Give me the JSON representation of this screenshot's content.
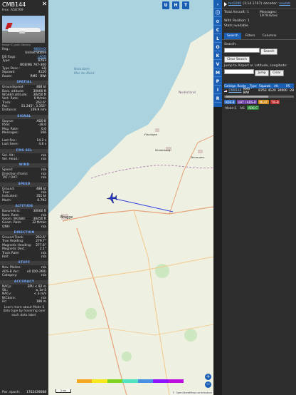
{
  "left": {
    "callsign": "CMB144",
    "hex_line": "Hex: A58769",
    "photo_credit": "Image © Justin Stevens",
    "basic": [
      {
        "k": "Reg.:",
        "v": "N669AX",
        "link": true
      },
      {
        "k": "",
        "v": "United States",
        "link": false
      },
      {
        "k": "DB flags:",
        "v": "LADD",
        "link": true
      },
      {
        "k": "Type:",
        "v": "B763",
        "link": false
      },
      {
        "k": "",
        "v": "BOEING 767-300",
        "link": false
      },
      {
        "k": "Type Desc.:",
        "v": "L2J",
        "link": false
      },
      {
        "k": "Squawk:",
        "v": "4120",
        "link": false
      },
      {
        "k": "Route:",
        "v": "RMS - BWI",
        "link": false
      }
    ],
    "sections": [
      {
        "title": "SPATIAL",
        "rows": [
          {
            "k": "Groundspeed:",
            "v": "488 kt"
          },
          {
            "k": "Baro. altitude:",
            "v": "30000 ft"
          },
          {
            "k": "WGS84 altitude:",
            "v": "30450 ft"
          },
          {
            "k": "Vert. Rate:",
            "v": "0 ft/min"
          },
          {
            "k": "Track:",
            "v": "263.6°"
          },
          {
            "k": "Pos.:",
            "v": "51.245°, 3.355°"
          },
          {
            "k": "Distance:",
            "v": "149.9 nmi"
          }
        ]
      },
      {
        "title": "SIGNAL",
        "rows": [
          {
            "k": "Source:",
            "v": "ADS-B"
          },
          {
            "k": "RSSI:",
            "v": "-28.0"
          },
          {
            "k": "Msg. Rate:",
            "v": "0.0"
          },
          {
            "k": "Messages:",
            "v": "166"
          },
          {
            "k": "",
            "v": ""
          },
          {
            "k": "Last Pos.:",
            "v": "14.2 s"
          },
          {
            "k": "Last Seen:",
            "v": "4.6 s"
          }
        ]
      },
      {
        "title": "FMS SEL",
        "rows": [
          {
            "k": "Sel. Alt.:",
            "v": "n/a"
          },
          {
            "k": "Sel. Head.:",
            "v": "n/a"
          }
        ]
      },
      {
        "title": "WIND",
        "rows": [
          {
            "k": "Speed:",
            "v": "n/a"
          },
          {
            "k": "Direction (from):",
            "v": "n/a"
          },
          {
            "k": "TAT / OAT:",
            "v": "n/a"
          }
        ]
      },
      {
        "title": "SPEED",
        "rows": [
          {
            "k": "Ground:",
            "v": "488 kt"
          },
          {
            "k": "True:",
            "v": "n/a"
          },
          {
            "k": "Indicated:",
            "v": "351 kt"
          },
          {
            "k": "Mach:",
            "v": "0.792"
          }
        ]
      },
      {
        "title": "ALTITUDE",
        "rows": [
          {
            "k": "Barometric:",
            "v": "30000 ft"
          },
          {
            "k": "Baro. Rate:",
            "v": "n/a"
          },
          {
            "k": "Geom. WGS84:",
            "v": "30450 ft"
          },
          {
            "k": "Geom. Rate:",
            "v": "32 ft/min"
          },
          {
            "k": "QNH:",
            "v": "n/a"
          }
        ]
      },
      {
        "title": "DIRECTION",
        "rows": [
          {
            "k": "Ground Track:",
            "v": "263.6°"
          },
          {
            "k": "True Heading:",
            "v": "279.7°"
          },
          {
            "k": "Magnetic Heading:",
            "v": "277.6°"
          },
          {
            "k": "Magnetic Decl.:",
            "v": "2.1°"
          },
          {
            "k": "Track Rate:",
            "v": "n/a"
          },
          {
            "k": "Roll:",
            "v": "n/a"
          }
        ]
      },
      {
        "title": "STUFF",
        "rows": [
          {
            "k": "Nav. Modes:",
            "v": "n/a"
          },
          {
            "k": "ADS-B Ver.:",
            "v": "v0 (DO-260)"
          },
          {
            "k": "Category:",
            "v": "n/a"
          }
        ]
      },
      {
        "title": "ACCURACY",
        "rows": [
          {
            "k": "NACp:",
            "v": "EPU < 92 m"
          },
          {
            "k": "SIL:",
            "v": "≤ 1e-5"
          },
          {
            "k": "NACv:",
            "v": "< 3 m/s"
          },
          {
            "k": "NICbaro:",
            "v": "n/a"
          },
          {
            "k": "Rc:",
            "v": "186 m"
          }
        ]
      }
    ],
    "footnote": "Learn more about Mode S data type by hovering over each data label.",
    "epoch_label": "Pos. epoch:",
    "epoch_value": "1762439088"
  },
  "map": {
    "top_buttons": [
      "U",
      "H",
      "T"
    ],
    "labels": [
      {
        "t": "Noordzee"
      },
      {
        "t": "Mer du Nord"
      },
      {
        "t": "Nederland"
      },
      {
        "t": "Brugge"
      },
      {
        "t": "Middelburg"
      },
      {
        "t": "Vlissingen"
      },
      {
        "t": "Terneuzen"
      }
    ],
    "scale": "2 km",
    "attribution": "© OpenStreetMap contributors",
    "zoom_in": "+",
    "zoom_out": "−",
    "aircraft_track_deg": 263.6,
    "track_color": "#3344dd",
    "altitude_bar_colors": [
      "#f5a623",
      "#f8e71c",
      "#7ed321",
      "#50e3c2",
      "#4a90e2",
      "#9013fe",
      "#bd10e0"
    ]
  },
  "toolbar": {
    "buttons": [
      "C",
      "L",
      "O",
      "K",
      "V",
      "M",
      "P",
      "I",
      "R"
    ],
    "top_buttons": [
      "›",
      "ⓘ",
      "⚙"
    ]
  },
  "right": {
    "app_link": "tar1090",
    "version": "(3.14.1767)",
    "decoder_label": "decoder:",
    "decoder_link": "readsb",
    "total_label": "Total Aircraft:",
    "total_value": "1",
    "messages_label": "Messages:",
    "messages_value": "1979.6/sec",
    "withpos_label": "With Position:",
    "withpos_value": "1",
    "stats_label": "Stats available",
    "tabs": [
      "Search",
      "Filters",
      "Columns"
    ],
    "search_label": "Search:",
    "search_button": "Search",
    "clear_button": "Clear Search",
    "jump_label": "Jump to Airport or Latitude, Longitude:",
    "jump_button": "Jump",
    "jump_clear": "Clear",
    "table_headers": [
      "Callsign",
      "Route",
      "Type",
      "Squawk",
      "Alt.",
      "RS"
    ],
    "row": {
      "callsign": "CMB144",
      "route": "RMS - BWI",
      "type": "B763",
      "squawk": "4120",
      "alt": "30000",
      "rssi": "-28"
    },
    "tags": [
      {
        "t": "ADS-B",
        "bg": "#2f6fc7",
        "fg": "#fff"
      },
      {
        "t": "UAT / ADS-R",
        "bg": "#6b3fa0",
        "fg": "#fff"
      },
      {
        "t": "MLAT",
        "bg": "#d28e18",
        "fg": "#fff"
      },
      {
        "t": "TIS-B",
        "bg": "#c03030",
        "fg": "#fff"
      },
      {
        "t": "Mode-S",
        "bg": "#2d2d2d",
        "fg": "#ddd"
      },
      {
        "t": "AIS",
        "bg": "#2d2d2d",
        "fg": "#ddd"
      },
      {
        "t": "ADS-C",
        "bg": "#2f8a3a",
        "fg": "#fff"
      }
    ]
  }
}
